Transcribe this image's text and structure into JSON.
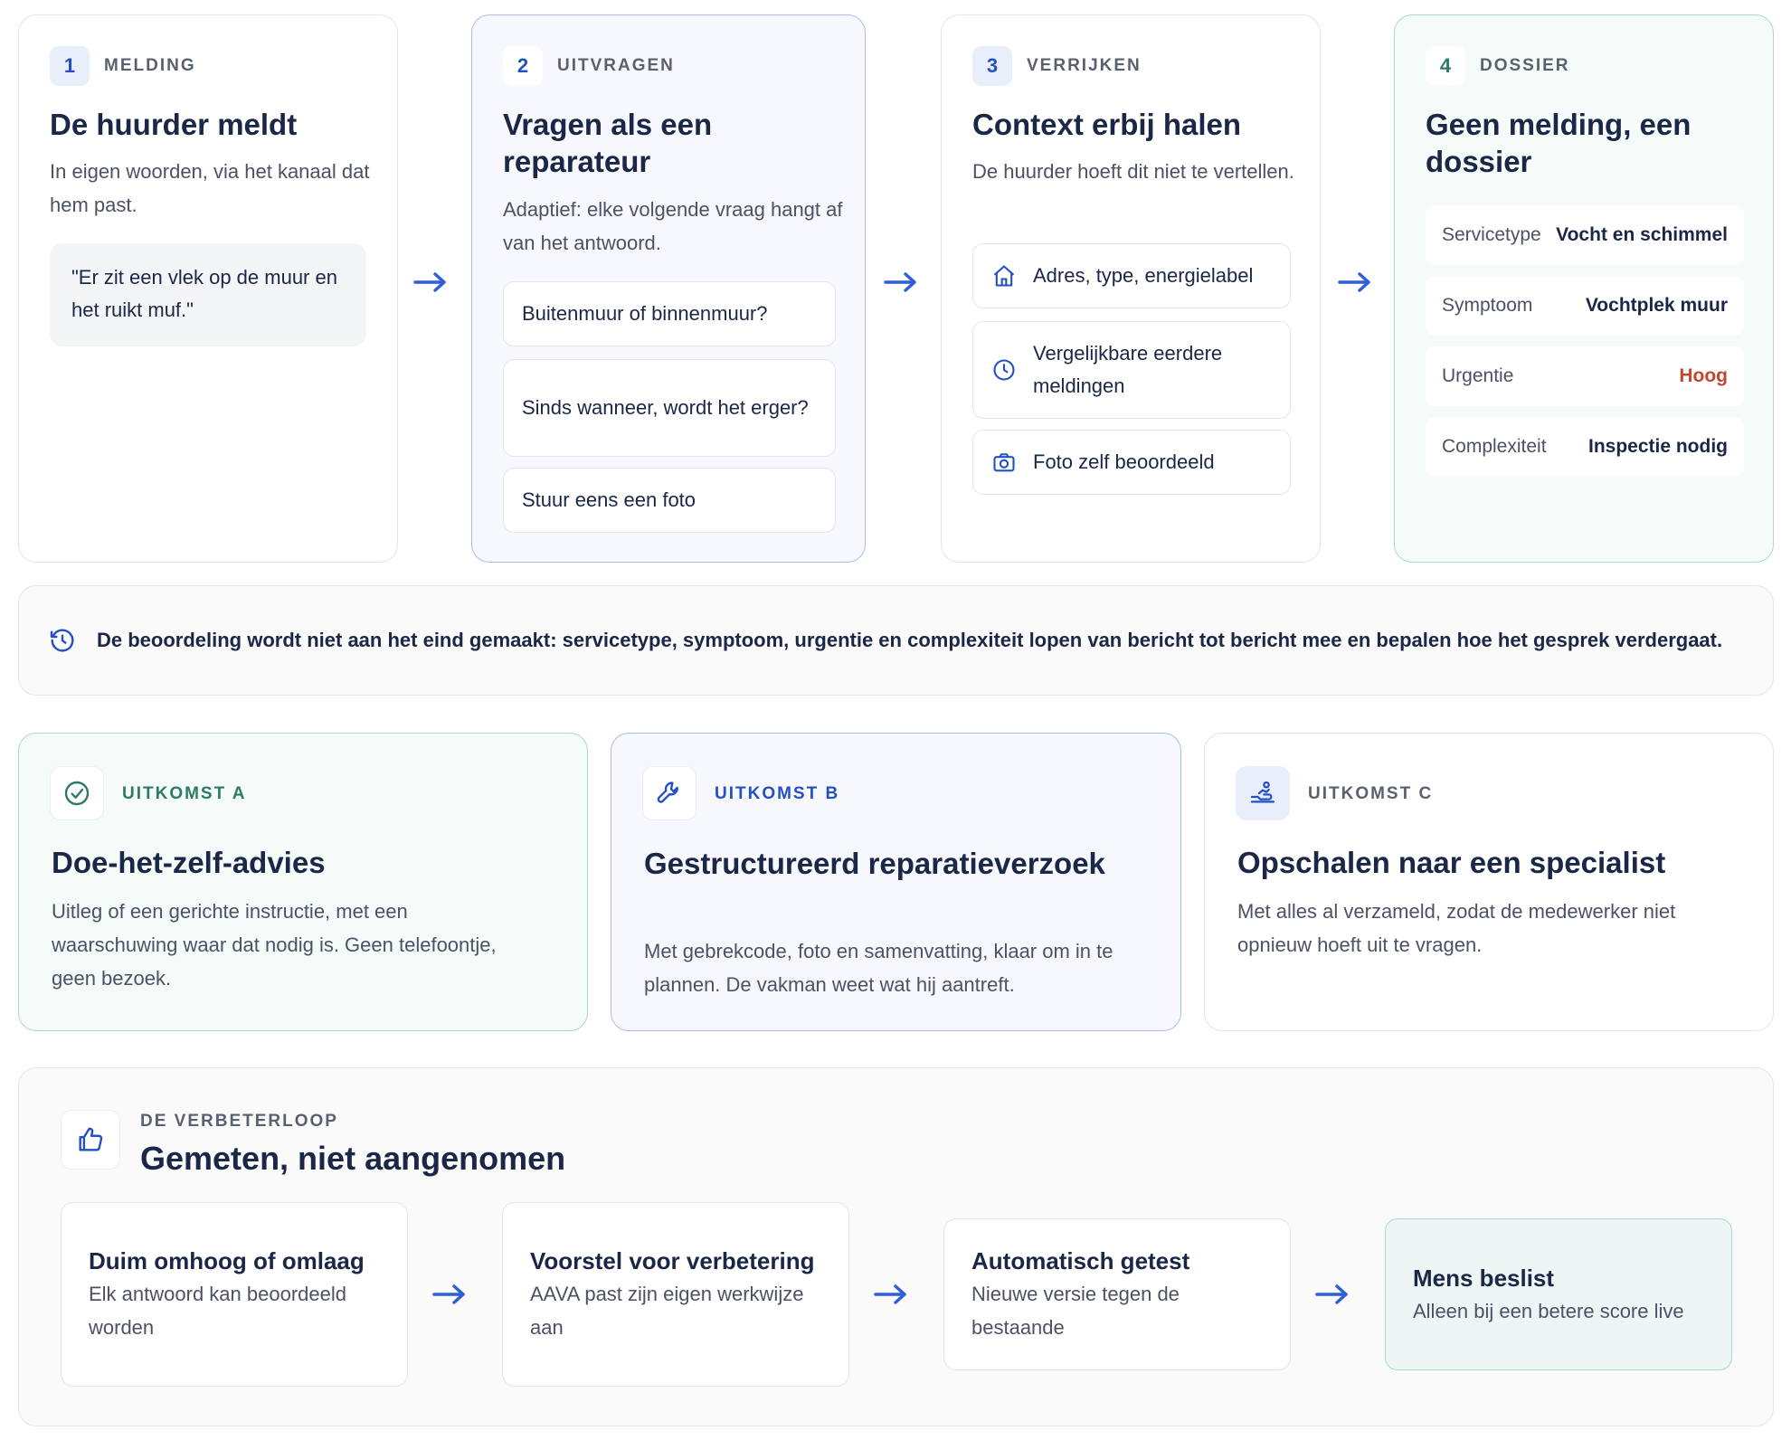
{
  "steps": [
    {
      "num": "1",
      "label": "MELDING",
      "title": "De huurder meldt",
      "desc": "In eigen woorden, via het kanaal dat hem past.",
      "quote": "\"Er zit een vlek op de muur en het ruikt muf.\""
    },
    {
      "num": "2",
      "label": "UITVRAGEN",
      "title": "Vragen als een reparateur",
      "desc": "Adaptief: elke volgende vraag hangt af van het antwoord.",
      "questions": [
        "Buitenmuur of binnenmuur?",
        "Sinds wanneer, wordt het erger?",
        "Stuur eens een foto"
      ]
    },
    {
      "num": "3",
      "label": "VERRIJKEN",
      "title": "Context erbij halen",
      "desc": "De huurder hoeft dit niet te vertellen.",
      "items": [
        {
          "icon": "house-icon",
          "text": "Adres, type, energielabel"
        },
        {
          "icon": "clock-icon",
          "text": "Vergelijkbare eerdere meldingen"
        },
        {
          "icon": "camera-icon",
          "text": "Foto zelf beoordeeld"
        }
      ]
    },
    {
      "num": "4",
      "label": "DOSSIER",
      "title": "Geen melding, een dossier",
      "rows": [
        {
          "key": "Servicetype",
          "value": "Vocht en schimmel"
        },
        {
          "key": "Symptoom",
          "value": "Vochtplek muur"
        },
        {
          "key": "Urgentie",
          "value": "Hoog"
        },
        {
          "key": "Complexiteit",
          "value": "Inspectie nodig"
        }
      ]
    }
  ],
  "arrow_glyph": "→",
  "note": {
    "icon": "history-icon",
    "text": "De beoordeling wordt niet aan het eind gemaakt: servicetype, symptoom, urgentie en complexiteit lopen van bericht tot bericht mee en bepalen hoe het gesprek verdergaat."
  },
  "outcomes": [
    {
      "icon": "check-circle-icon",
      "label": "UITKOMST A",
      "title": "Doe-het-zelf-advies",
      "desc": "Uitleg of een gerichte instructie, met een waarschuwing waar dat nodig is. Geen telefoontje, geen bezoek."
    },
    {
      "icon": "wrench-icon",
      "label": "UITKOMST B",
      "title": "Gestructureerd reparatieverzoek",
      "desc": "Met gebrekcode, foto en samenvatting, klaar om in te plannen. De vakman weet wat hij aantreft."
    },
    {
      "icon": "escalate-icon",
      "label": "UITKOMST C",
      "title": "Opschalen naar een specialist",
      "desc": "Met alles al verzameld, zodat de medewerker niet opnieuw hoeft uit te vragen."
    }
  ],
  "loop": {
    "icon": "thumbs-up-icon",
    "label": "DE VERBETERLOOP",
    "title": "Gemeten, niet aangenomen",
    "steps": [
      {
        "title": "Duim omhoog of omlaag",
        "desc": "Elk antwoord kan beoordeeld worden"
      },
      {
        "title": "Voorstel voor verbetering",
        "desc": "AAVA past zijn eigen werkwijze aan"
      },
      {
        "title": "Automatisch getest",
        "desc": "Nieuwe versie tegen de bestaande"
      },
      {
        "title": "Mens beslist",
        "desc": "Alleen bij een betere score live"
      }
    ]
  },
  "colors": {
    "accent": "#2450c4",
    "arrow": "#2f5fd6",
    "teal": "#2e7a68",
    "urgent": "#c0462d",
    "ink": "#1b2747"
  }
}
